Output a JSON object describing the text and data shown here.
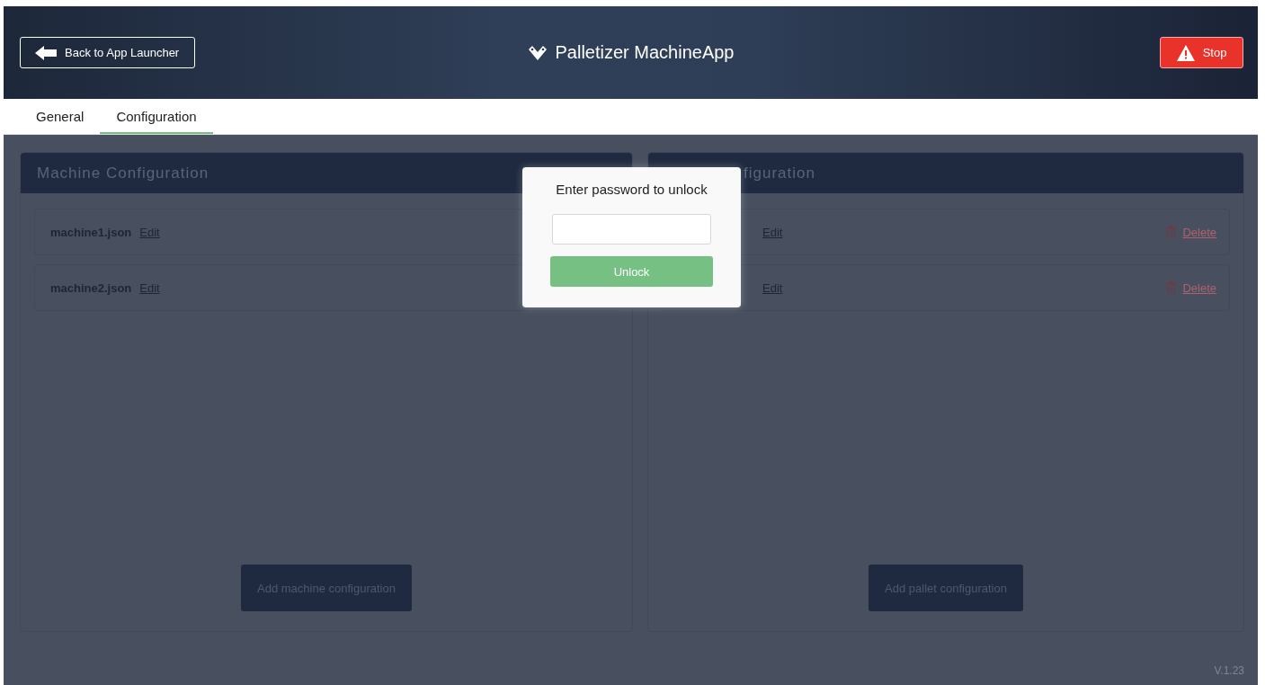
{
  "header": {
    "back_button": "Back to App Launcher",
    "title": "Palletizer MachineApp",
    "stop_button": "Stop"
  },
  "tabs": [
    {
      "label": "General",
      "selected": false
    },
    {
      "label": "Configuration",
      "selected": true
    }
  ],
  "panels": [
    {
      "title": "Machine Configuration",
      "title_hidden": false,
      "rows": [
        {
          "file": "machine1.json",
          "edit": "Edit"
        },
        {
          "file": "machine2.json",
          "edit": "Edit"
        }
      ],
      "add_button": "Add machine configuration"
    },
    {
      "title": "figuration",
      "title_hidden": true,
      "rows": [
        {
          "edit": "Edit",
          "delete": "Delete"
        },
        {
          "edit": "Edit",
          "delete": "Delete"
        }
      ],
      "add_button": "Add pallet configuration"
    }
  ],
  "version": "V.1.23",
  "dialog": {
    "title": "Enter password to unlock",
    "button": "Unlock"
  }
}
